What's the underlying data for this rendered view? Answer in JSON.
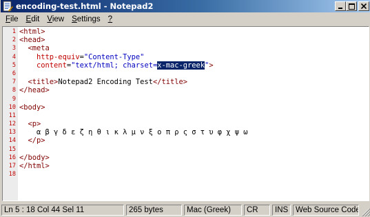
{
  "window": {
    "title": "encoding-test.html - Notepad2",
    "title_color": "#ffffff",
    "titlebar_gradient": [
      "#0a246a",
      "#a6caf0"
    ]
  },
  "menu": [
    {
      "pre": "",
      "acc": "F",
      "post": "ile"
    },
    {
      "pre": "",
      "acc": "E",
      "post": "dit"
    },
    {
      "pre": "",
      "acc": "V",
      "post": "iew"
    },
    {
      "pre": "",
      "acc": "S",
      "post": "ettings"
    },
    {
      "pre": "",
      "acc": "?",
      "post": ""
    }
  ],
  "editor": {
    "line_numbers": [
      "1",
      "2",
      "3",
      "4",
      "5",
      "6",
      "7",
      "8",
      "9",
      "10",
      "11",
      "12",
      "13",
      "14",
      "15",
      "16",
      "17",
      "18"
    ],
    "colors": {
      "tag": "#800000",
      "attribute": "#c00000",
      "string": "#0000c0",
      "selection": "#0a246a",
      "line_number": "#c00000"
    },
    "lines": [
      [
        {
          "t": "tag",
          "v": "<html>"
        }
      ],
      [
        {
          "t": "tag",
          "v": "<head>"
        }
      ],
      [
        {
          "t": "txt",
          "v": "  "
        },
        {
          "t": "tag",
          "v": "<meta"
        }
      ],
      [
        {
          "t": "txt",
          "v": "    "
        },
        {
          "t": "attr",
          "v": "http-equiv"
        },
        {
          "t": "txt",
          "v": "="
        },
        {
          "t": "str",
          "v": "\"Content-Type\""
        }
      ],
      [
        {
          "t": "txt",
          "v": "    "
        },
        {
          "t": "attr",
          "v": "content"
        },
        {
          "t": "txt",
          "v": "="
        },
        {
          "t": "str",
          "v": "\"text/html; charset="
        },
        {
          "t": "sel",
          "v": "x-mac-greek"
        },
        {
          "t": "str",
          "v": "\""
        },
        {
          "t": "tag",
          "v": ">"
        }
      ],
      [],
      [
        {
          "t": "txt",
          "v": "  "
        },
        {
          "t": "tag",
          "v": "<title>"
        },
        {
          "t": "txt",
          "v": "Notepad2 Encoding Test"
        },
        {
          "t": "tag",
          "v": "</title>"
        }
      ],
      [
        {
          "t": "tag",
          "v": "</head>"
        }
      ],
      [],
      [
        {
          "t": "tag",
          "v": "<body>"
        }
      ],
      [],
      [
        {
          "t": "txt",
          "v": "  "
        },
        {
          "t": "tag",
          "v": "<p>"
        }
      ],
      [
        {
          "t": "txt",
          "v": "    α β γ δ ε ζ η θ ι κ λ μ ν ξ ο π ρ ς σ τ υ φ χ ψ ω"
        }
      ],
      [
        {
          "t": "txt",
          "v": "  "
        },
        {
          "t": "tag",
          "v": "</p>"
        }
      ],
      [],
      [
        {
          "t": "tag",
          "v": "</body>"
        }
      ],
      [
        {
          "t": "tag",
          "v": "</html>"
        }
      ],
      []
    ]
  },
  "status": {
    "position": "Ln 5 : 18   Col 44   Sel 11",
    "size": "265 bytes",
    "encoding": "Mac (Greek)",
    "line_ending": "CR",
    "mode": "INS",
    "scheme": "Web Source Code"
  }
}
